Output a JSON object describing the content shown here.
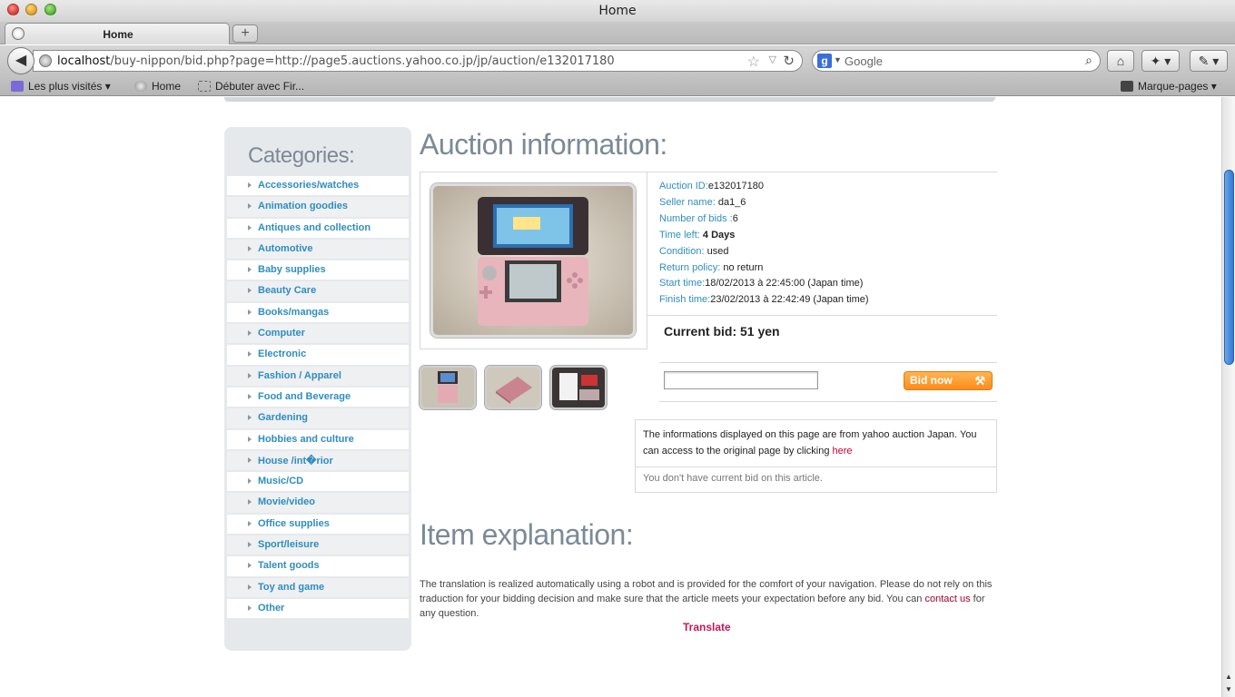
{
  "window": {
    "title": "Home"
  },
  "tabs": [
    {
      "label": "Home"
    }
  ],
  "toolbar": {
    "url_host": "localhost",
    "url_path": "/buy-nippon/bid.php?page=http://page5.auctions.yahoo.co.jp/jp/auction/e132017180",
    "search_placeholder": "Google",
    "search_engine_icon": "g-icon"
  },
  "bookmarks": {
    "most_visited": "Les plus visités",
    "home": "Home",
    "get_started": "Débuter avec Fir...",
    "bookmarks_menu": "Marque-pages"
  },
  "sidebar": {
    "title": "Categories:",
    "items": [
      "Accessories/watches",
      "Animation goodies",
      "Antiques and collection",
      "Automotive",
      "Baby supplies",
      "Beauty Care",
      "Books/mangas",
      "Computer",
      "Electronic",
      "Fashion / Apparel",
      "Food and Beverage",
      "Gardening",
      "Hobbies and culture",
      "House /int�rior",
      "Music/CD",
      "Movie/video",
      "Office supplies",
      "Sport/leisure",
      "Talent goods",
      "Toy and game",
      "Other"
    ]
  },
  "auction": {
    "heading": "Auction information:",
    "id_label": "Auction ID:",
    "id_value": "e132017180",
    "seller_label": "Seller name:",
    "seller_value": "da1_6",
    "bids_label": "Number of bids :",
    "bids_value": "6",
    "time_left_label": "Time left:",
    "time_left_value": "4 Days",
    "condition_label": "Condition:",
    "condition_value": "used",
    "return_label": "Return policy:",
    "return_value": "no return",
    "start_label": "Start time:",
    "start_value": "18/02/2013 à 22:45:00 (Japan time)",
    "finish_label": "Finish time:",
    "finish_value": "23/02/2013 à 22:42:49 (Japan time)",
    "current_bid": "Current bid: 51 yen",
    "bid_input_value": "",
    "bid_button": "Bid now"
  },
  "notice": {
    "text": "The informations displayed on this page are from yahoo auction Japan. You can access to the original page by clicking",
    "link": "here",
    "no_bid": "You don't have current bid on this article."
  },
  "explanation": {
    "heading": "Item explanation:",
    "text_before": "The translation is realized automatically using a robot and is provided for the comfort of your navigation. Please do not rely on this traduction for your bidding decision and make sure that the article meets your expectation before any bid. You can",
    "contact_link": "contact us",
    "text_after": "for any question.",
    "translate_link": "Translate"
  },
  "colors": {
    "link_blue": "#2f8dc0",
    "heading_gray": "#7b8a97",
    "bid_orange": "#ff8c1a",
    "alert_red": "#cc0033"
  }
}
